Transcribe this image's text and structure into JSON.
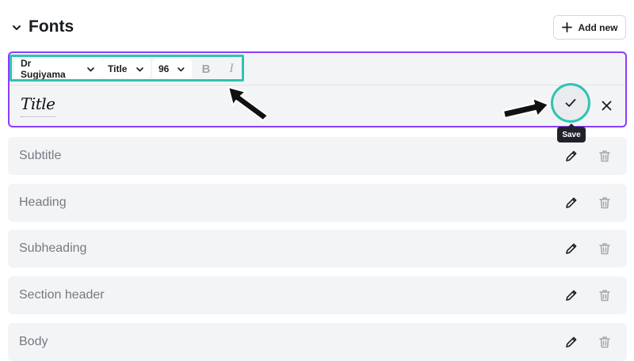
{
  "header": {
    "title": "Fonts",
    "add_new_label": "Add new"
  },
  "editor": {
    "font_family": "Dr Sugiyama",
    "text_style": "Title",
    "font_size": "96",
    "bold_glyph": "B",
    "italic_glyph": "I",
    "preview_text": "Title",
    "save_tooltip": "Save"
  },
  "font_rows": [
    {
      "label": "Subtitle"
    },
    {
      "label": "Heading"
    },
    {
      "label": "Subheading"
    },
    {
      "label": "Section header"
    },
    {
      "label": "Body"
    }
  ],
  "colors": {
    "accent_purple": "#8b3dff",
    "highlight_teal": "#2ec4b0",
    "row_bg": "#f3f4f6",
    "tooltip_bg": "#1f2329"
  },
  "icons": [
    "chevron-down-icon",
    "plus-icon",
    "check-icon",
    "close-icon",
    "pencil-icon",
    "trash-icon",
    "annotation-arrow-icon"
  ]
}
